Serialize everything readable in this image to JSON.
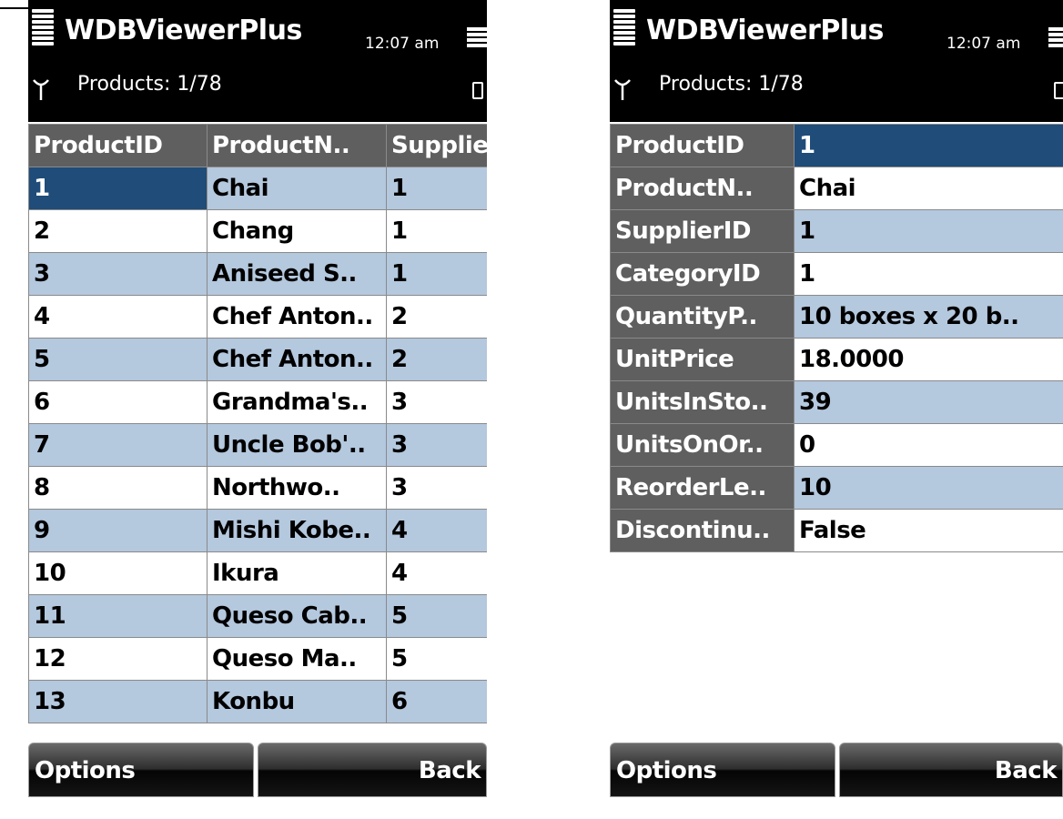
{
  "app": {
    "title": "WDBViewerPlus",
    "time": "12:07 am",
    "subtitle": "Products: 1/78"
  },
  "list_view": {
    "columns": [
      "ProductID",
      "ProductN..",
      "Supplie"
    ],
    "rows": [
      [
        "1",
        "Chai",
        "1"
      ],
      [
        "2",
        "Chang",
        "1"
      ],
      [
        "3",
        "Aniseed S..",
        "1"
      ],
      [
        "4",
        "Chef Anton..",
        "2"
      ],
      [
        "5",
        "Chef Anton..",
        "2"
      ],
      [
        "6",
        "Grandma's..",
        "3"
      ],
      [
        "7",
        "Uncle Bob'..",
        "3"
      ],
      [
        "8",
        "Northwo..",
        "3"
      ],
      [
        "9",
        "Mishi Kobe..",
        "4"
      ],
      [
        "10",
        "Ikura",
        "4"
      ],
      [
        "11",
        "Queso Cab..",
        "5"
      ],
      [
        "12",
        "Queso Ma..",
        "5"
      ],
      [
        "13",
        "Konbu",
        "6"
      ]
    ]
  },
  "detail_view": {
    "fields": [
      {
        "label": "ProductID",
        "value": "1"
      },
      {
        "label": "ProductN..",
        "value": "Chai"
      },
      {
        "label": "SupplierID",
        "value": "1"
      },
      {
        "label": "CategoryID",
        "value": "1"
      },
      {
        "label": "QuantityP..",
        "value": "10 boxes x 20 b.."
      },
      {
        "label": "UnitPrice",
        "value": "18.0000"
      },
      {
        "label": "UnitsInSto..",
        "value": "39"
      },
      {
        "label": "UnitsOnOr..",
        "value": "0"
      },
      {
        "label": "ReorderLe..",
        "value": "10"
      },
      {
        "label": "Discontinu..",
        "value": "False"
      }
    ]
  },
  "softkeys": {
    "left": "Options",
    "right": "Back"
  },
  "icons": {
    "menu": "menu-icon",
    "battery": "battery-icon",
    "signal": "signal-icon"
  },
  "colors": {
    "header_bg": "#000000",
    "column_header_bg": "#5f5f5f",
    "row_alt_bg": "#b4c8de",
    "selected_bg": "#1f4c79"
  }
}
